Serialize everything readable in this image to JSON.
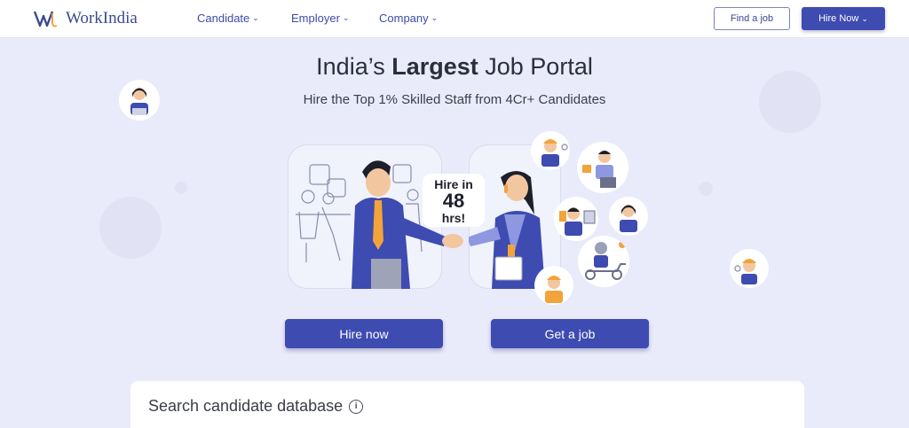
{
  "header": {
    "logo_text": "WorkIndia",
    "nav": [
      {
        "label": "Candidate"
      },
      {
        "label": "Employer"
      },
      {
        "label": "Company"
      }
    ],
    "find_job_label": "Find a job",
    "hire_now_label": "Hire Now"
  },
  "hero": {
    "title_pre": "India’s ",
    "title_bold": "Largest",
    "title_post": " Job Portal",
    "subtitle": "Hire the Top 1% Skilled Staff from 4Cr+ Candidates",
    "bubble": {
      "line1": "Hire in",
      "line2": "48",
      "line3": "hrs!"
    }
  },
  "cta": {
    "hire_now": "Hire now",
    "get_job": "Get a job"
  },
  "search": {
    "title": "Search candidate database",
    "info_glyph": "i"
  },
  "colors": {
    "brand": "#3e4bb0",
    "background": "#e9ebfa",
    "accent_orange": "#f2a33a"
  }
}
